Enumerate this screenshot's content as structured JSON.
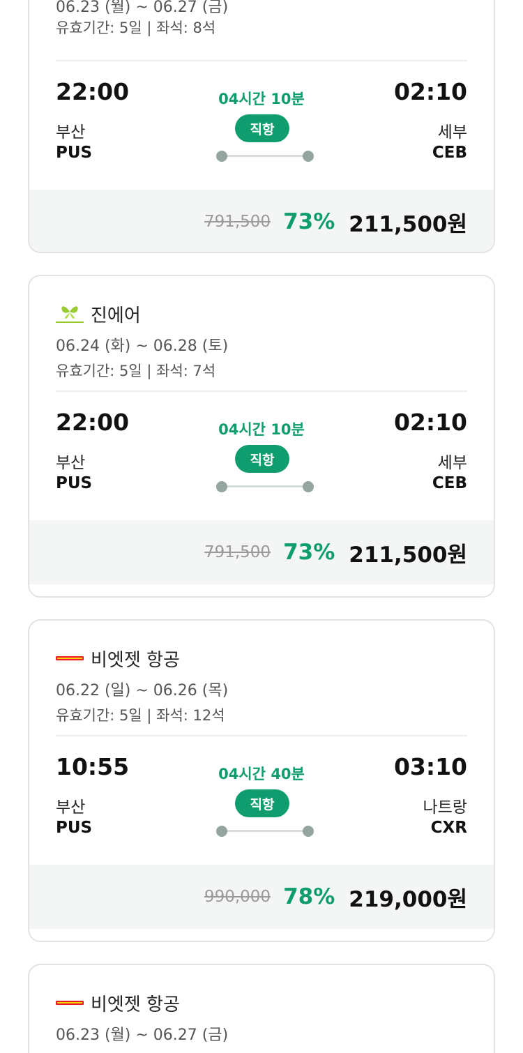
{
  "colors": {
    "accent": "#0f9d6f",
    "jinair_logo": "#9acd32",
    "vietjet_logo": "#e31e24"
  },
  "cards": [
    {
      "airline": "",
      "dates": "06.23 (월) ~ 06.27 (금)",
      "validity": "유효기간: 5일 | 좌석: 8석",
      "dep_time": "22:00",
      "dep_city": "부산",
      "dep_code": "PUS",
      "arr_time": "02:10",
      "arr_city": "세부",
      "arr_code": "CEB",
      "duration": "04시간 10분",
      "badge": "직항",
      "orig_price": "791,500",
      "discount": "73%",
      "final_price": "211,500원"
    },
    {
      "airline": "진에어",
      "logo": "jinair-logo-icon",
      "dates": "06.24 (화) ~ 06.28 (토)",
      "validity": "유효기간: 5일 | 좌석: 7석",
      "dep_time": "22:00",
      "dep_city": "부산",
      "dep_code": "PUS",
      "arr_time": "02:10",
      "arr_city": "세부",
      "arr_code": "CEB",
      "duration": "04시간 10분",
      "badge": "직항",
      "orig_price": "791,500",
      "discount": "73%",
      "final_price": "211,500원"
    },
    {
      "airline": "비엣젯 항공",
      "logo": "vietjet-logo-icon",
      "dates": "06.22 (일) ~ 06.26 (목)",
      "validity": "유효기간: 5일 | 좌석: 12석",
      "dep_time": "10:55",
      "dep_city": "부산",
      "dep_code": "PUS",
      "arr_time": "03:10",
      "arr_city": "나트랑",
      "arr_code": "CXR",
      "duration": "04시간 40분",
      "badge": "직항",
      "orig_price": "990,000",
      "discount": "78%",
      "final_price": "219,000원"
    },
    {
      "airline": "비엣젯 항공",
      "logo": "vietjet-logo-icon",
      "dates": "06.23 (월) ~ 06.27 (금)"
    }
  ]
}
